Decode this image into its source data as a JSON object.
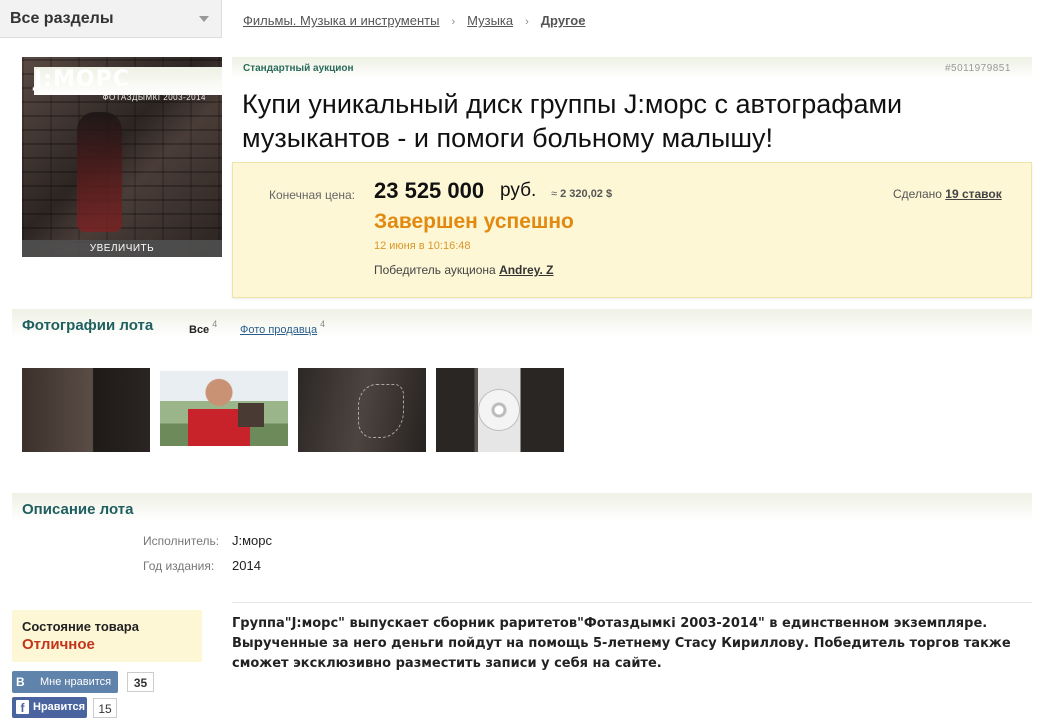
{
  "topbar": {
    "sections_label": "Все разделы",
    "breadcrumbs": [
      "Фильмы. Музыка и инструменты",
      "Музыка",
      "Другое"
    ]
  },
  "cover": {
    "band_text": "J:МОРС",
    "album_text": "ФОТАЗДЫМКI 2003-2014",
    "zoom_label": "УВЕЛИЧИТЬ"
  },
  "lot": {
    "auction_type": "Стандартный аукцион",
    "lot_id": "#5011979851",
    "title": "Купи уникальный диск группы J:морс с автографами музыкантов - и помоги больному малышу!"
  },
  "price": {
    "label": "Конечная цена:",
    "amount": "23 525 000",
    "currency": "руб.",
    "approx_prefix": "≈",
    "approx_usd": "2 320,02 $",
    "bids_prefix": "Сделано",
    "bids_link": "19 ставок",
    "status": "Завершен успешно",
    "end_date": "12 июня в 10:16:48",
    "winner_label": "Победитель аукциона",
    "winner_name": "Andrey. Z"
  },
  "photos": {
    "title": "Фотографии лота",
    "tab_all": "Все",
    "tab_all_count": "4",
    "tab_seller": "Фото продавца",
    "tab_seller_count": "4"
  },
  "description": {
    "title": "Описание лота",
    "fields": [
      {
        "key": "Исполнитель:",
        "value": "J:морс"
      },
      {
        "key": "Год издания:",
        "value": "2014"
      }
    ],
    "text": "Группа\"J:морс\" выпускает сборник раритетов\"Фотаздымкi 2003-2014\" в единственном экземпляре. Вырученные за него деньги пойдут на помощь 5-летнему Стасу Кириллову. Победитель торгов также сможет эксклюзивно разместить записи у себя на сайте."
  },
  "condition": {
    "label": "Состояние товара",
    "value": "Отличное"
  },
  "social": {
    "vk_icon": "В",
    "vk_label": "Мне нравится",
    "vk_count": "35",
    "fb_icon": "f",
    "fb_label": "Нравится",
    "fb_count": "15"
  }
}
